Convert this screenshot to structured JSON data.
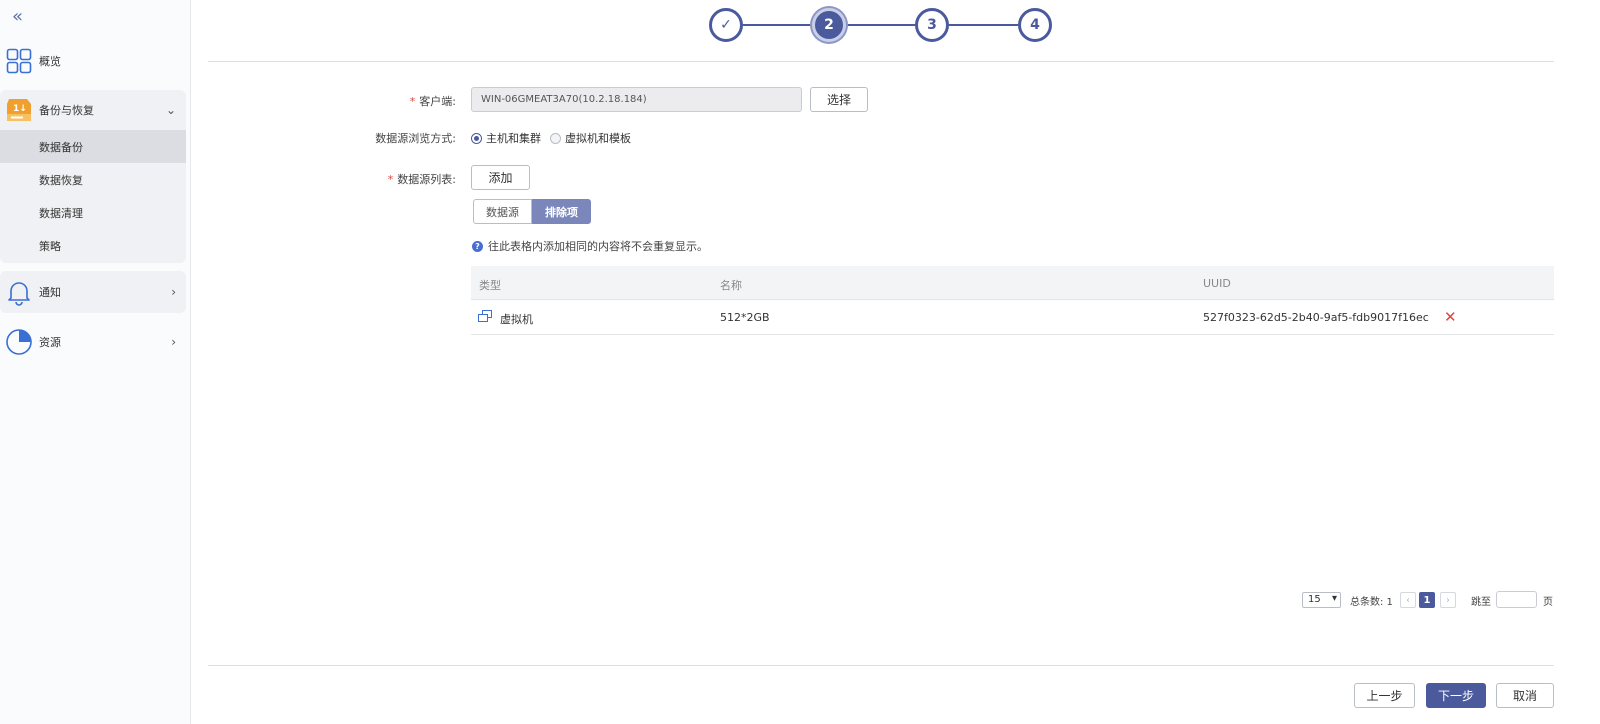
{
  "sidebar": {
    "collapse_glyph": "«",
    "overview": {
      "label": "概览",
      "icon": "grid-icon"
    },
    "backup": {
      "label": "备份与恢复",
      "icon": "backup-drive-icon",
      "items": [
        {
          "label": "数据备份",
          "active": true
        },
        {
          "label": "数据恢复",
          "active": false
        },
        {
          "label": "数据清理",
          "active": false
        },
        {
          "label": "策略",
          "active": false
        }
      ]
    },
    "notify": {
      "label": "通知",
      "icon": "bell-icon"
    },
    "resource": {
      "label": "资源",
      "icon": "pie-icon"
    }
  },
  "stepper": {
    "steps": [
      "✓",
      "2",
      "3",
      "4"
    ],
    "current": 2
  },
  "form": {
    "client_label": "客户端:",
    "client_value": "WIN-06GMEAT3A70(10.2.18.184)",
    "select_button": "选择",
    "browse_label": "数据源浏览方式:",
    "browse_options": [
      "主机和集群",
      "虚拟机和模板"
    ],
    "browse_selected": "主机和集群",
    "list_label": "数据源列表:",
    "add_button": "添加",
    "required_mark": "*",
    "tabs": [
      "数据源",
      "排除项"
    ],
    "active_tab": "排除项",
    "hint": "往此表格内添加相同的内容将不会重复显示。",
    "hint_icon": "?"
  },
  "table": {
    "columns": [
      "类型",
      "名称",
      "UUID"
    ],
    "rows": [
      {
        "type": "虚拟机",
        "name": "512*2GB",
        "uuid": "527f0323-62d5-2b40-9af5-fdb9017f16ec",
        "delete_glyph": "✕"
      }
    ]
  },
  "pagination": {
    "page_size": "15",
    "total_label": "总条数: 1",
    "prev": "‹",
    "current_page": "1",
    "next": "›",
    "jump_label": "跳至",
    "page_suffix": "页"
  },
  "footer": {
    "prev_button": "上一步",
    "next_button": "下一步",
    "cancel_button": "取消"
  },
  "colors": {
    "accent": "#4a5a9c",
    "danger": "#e0443e",
    "active_tab": "#7b87bb"
  }
}
